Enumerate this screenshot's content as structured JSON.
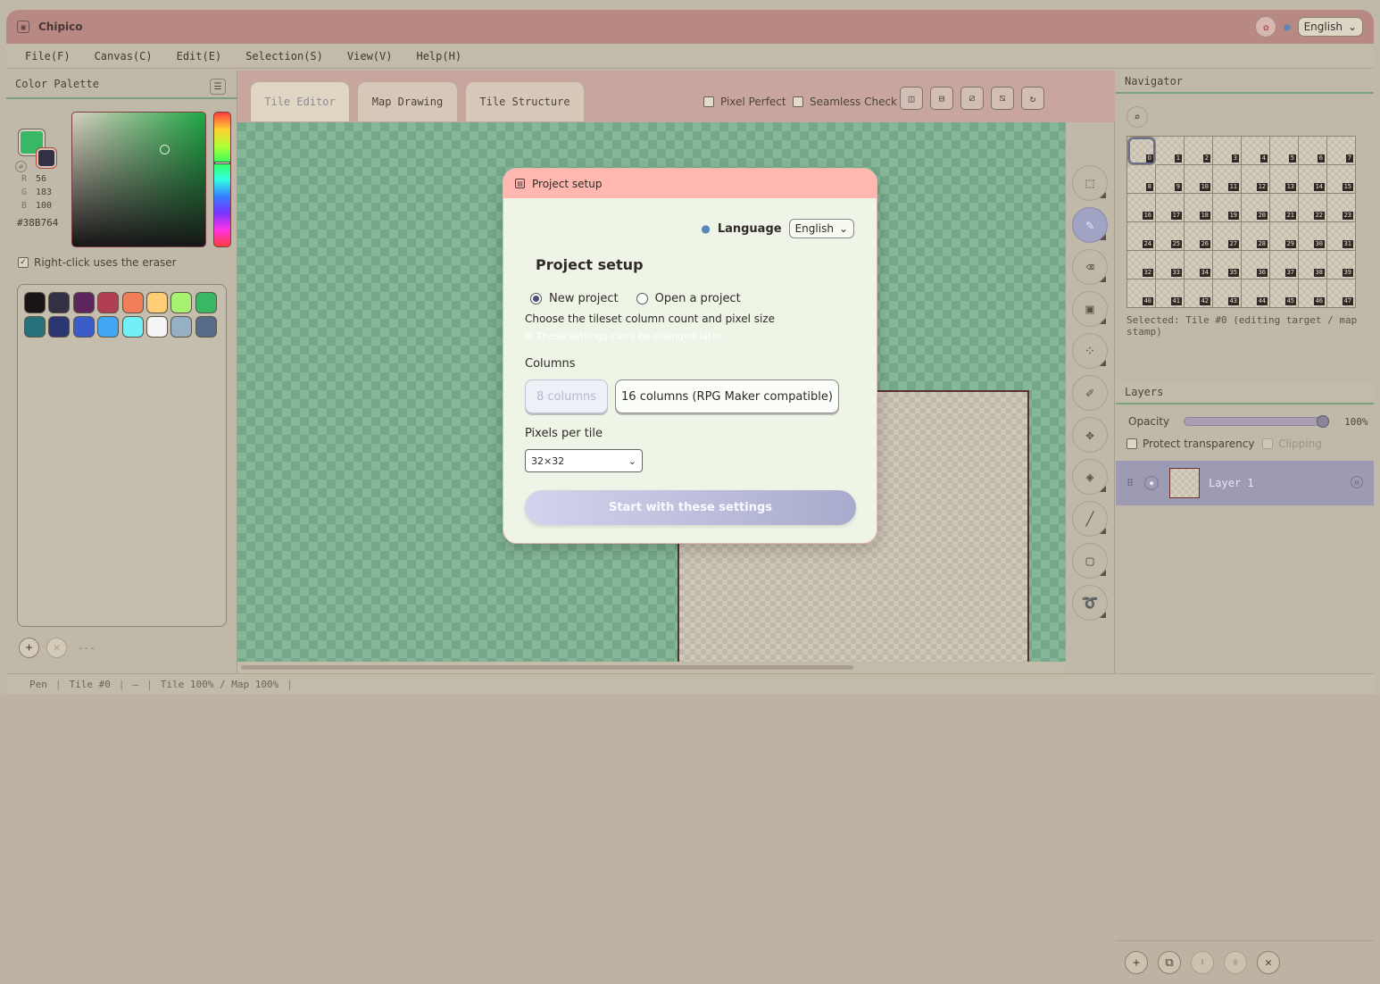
{
  "app": {
    "title": "Chipico",
    "language": "English"
  },
  "menu": [
    "File(F)",
    "Canvas(C)",
    "Edit(E)",
    "Selection(S)",
    "View(V)",
    "Help(H)"
  ],
  "palette_panel": {
    "title": "Color Palette",
    "fg_color": "#38b764",
    "bg_color": "#333044",
    "r_label": "R",
    "r": "56",
    "g_label": "G",
    "g": "183",
    "b_label": "B",
    "b": "100",
    "hex": "#38B764",
    "right_click_label": "Right-click uses the eraser",
    "right_click_checked": true,
    "colors": [
      "#1a1515",
      "#333044",
      "#5d275d",
      "#b13e53",
      "#ef7d57",
      "#ffcd75",
      "#a7f070",
      "#38b764",
      "#257179",
      "#29366f",
      "#3b5dc9",
      "#41a6f6",
      "#73eff7",
      "#f4f4f4",
      "#94b0c2",
      "#566c86"
    ],
    "footer_text": "---"
  },
  "tabs": [
    {
      "label": "Tile Editor",
      "active": true
    },
    {
      "label": "Map Drawing",
      "active": false
    },
    {
      "label": "Tile Structure",
      "active": false
    }
  ],
  "options": {
    "pixel_perfect": "Pixel Perfect",
    "seamless_check": "Seamless Check"
  },
  "navigator": {
    "title": "Navigator",
    "tiles": [
      0,
      1,
      2,
      3,
      4,
      5,
      6,
      7,
      8,
      9,
      10,
      11,
      12,
      13,
      14,
      15,
      16,
      17,
      18,
      19,
      20,
      21,
      22,
      23,
      24,
      25,
      26,
      27,
      28,
      29,
      30,
      31,
      32,
      33,
      34,
      35,
      36,
      37,
      38,
      39,
      40,
      41,
      42,
      43,
      44,
      45,
      46,
      47
    ],
    "selected_text": "Selected: Tile #0 (editing target / map stamp)"
  },
  "layers": {
    "title": "Layers",
    "opacity_label": "Opacity",
    "opacity_value": "100%",
    "opacity": 1.0,
    "protect_label": "Protect transparency",
    "clipping_label": "Clipping",
    "items": [
      {
        "name": "Layer 1"
      }
    ]
  },
  "status": {
    "tool": "Pen",
    "tile": "Tile #0",
    "dash": "–",
    "zoom": "Tile 100% / Map 100%"
  },
  "dialog": {
    "header": "Project setup",
    "language_label": "Language",
    "language_value": "English",
    "title": "Project setup",
    "radio_new": "New project",
    "radio_open": "Open a project",
    "description": "Choose the tileset column count and pixel size",
    "warning": "※ These settings can't be changed later",
    "columns_label": "Columns",
    "col_8": "8 columns",
    "col_16": "16 columns (RPG Maker compatible)",
    "pixels_label": "Pixels per tile",
    "pixels_value": "32×32",
    "start_button": "Start with these settings"
  }
}
